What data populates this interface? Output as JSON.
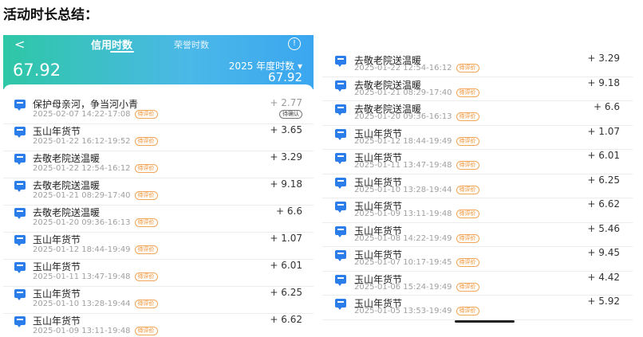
{
  "heading": "活动时长总结：",
  "header": {
    "back": "<",
    "tab_active": "信用时数",
    "tab_other": "荣誉时数",
    "info": "!",
    "total": "67.92",
    "year_label": "2025 年度时数 ▾",
    "year_total": "67.92"
  },
  "left_rows": [
    {
      "title": "保护母亲河，争当河小青",
      "time": "2025-02-07 14:22-17:08",
      "badge": "待评价",
      "points": "+ 2.77",
      "side_badge": "待确认"
    },
    {
      "title": "玉山年货节",
      "time": "2025-01-22 16:12-19:52",
      "badge": "待评价",
      "points": "+ 3.65"
    },
    {
      "title": "去敬老院送温暖",
      "time": "2025-01-22 12:54-16:12",
      "badge": "待评价",
      "points": "+ 3.29"
    },
    {
      "title": "去敬老院送温暖",
      "time": "2025-01-21 08:29-17:40",
      "badge": "待评价",
      "points": "+ 9.18"
    },
    {
      "title": "去敬老院送温暖",
      "time": "2025-01-20 09:36-16:13",
      "badge": "待评价",
      "points": "+ 6.6"
    },
    {
      "title": "玉山年货节",
      "time": "2025-01-12 18:44-19:49",
      "badge": "待评价",
      "points": "+ 1.07"
    },
    {
      "title": "玉山年货节",
      "time": "2025-01-11 13:47-19:48",
      "badge": "待评价",
      "points": "+ 6.01"
    },
    {
      "title": "玉山年货节",
      "time": "2025-01-10 13:28-19:44",
      "badge": "待评价",
      "points": "+ 6.25"
    },
    {
      "title": "玉山年货节",
      "time": "2025-01-09 13:11-19:48",
      "badge": "待评价",
      "points": "+ 6.62"
    }
  ],
  "right_rows": [
    {
      "title": "去敬老院送温暖",
      "time": "2025-01-22 12:54-16:12",
      "badge": "待评价",
      "points": "+ 3.29"
    },
    {
      "title": "去敬老院送温暖",
      "time": "2025-01-21 08:29-17:40",
      "badge": "待评价",
      "points": "+ 9.18"
    },
    {
      "title": "去敬老院送温暖",
      "time": "2025-01-20 09:36-16:13",
      "badge": "待评价",
      "points": "+ 6.6"
    },
    {
      "title": "玉山年货节",
      "time": "2025-01-12 18:44-19:49",
      "badge": "待评价",
      "points": "+ 1.07"
    },
    {
      "title": "玉山年货节",
      "time": "2025-01-11 13:47-19:48",
      "badge": "待评价",
      "points": "+ 6.01"
    },
    {
      "title": "玉山年货节",
      "time": "2025-01-10 13:28-19:44",
      "badge": "待评价",
      "points": "+ 6.25"
    },
    {
      "title": "玉山年货节",
      "time": "2025-01-09 13:11-19:48",
      "badge": "待评价",
      "points": "+ 6.62"
    },
    {
      "title": "玉山年货节",
      "time": "2025-01-08 14:22-19:49",
      "badge": "待评价",
      "points": "+ 5.46"
    },
    {
      "title": "玉山年货节",
      "time": "2025-01-07 10:17-19:45",
      "badge": "待评价",
      "points": "+ 9.45"
    },
    {
      "title": "玉山年货节",
      "time": "2025-01-06 15:24-19:49",
      "badge": "待评价",
      "points": "+ 4.42"
    },
    {
      "title": "玉山年货节",
      "time": "2025-01-05 13:53-19:49",
      "badge": "待评价",
      "points": "+ 5.92"
    }
  ],
  "colors": {
    "accent": "#2b7de9",
    "badge": "#f08a24",
    "header_start": "#2ec7a6",
    "header_end": "#3aa6f0"
  }
}
